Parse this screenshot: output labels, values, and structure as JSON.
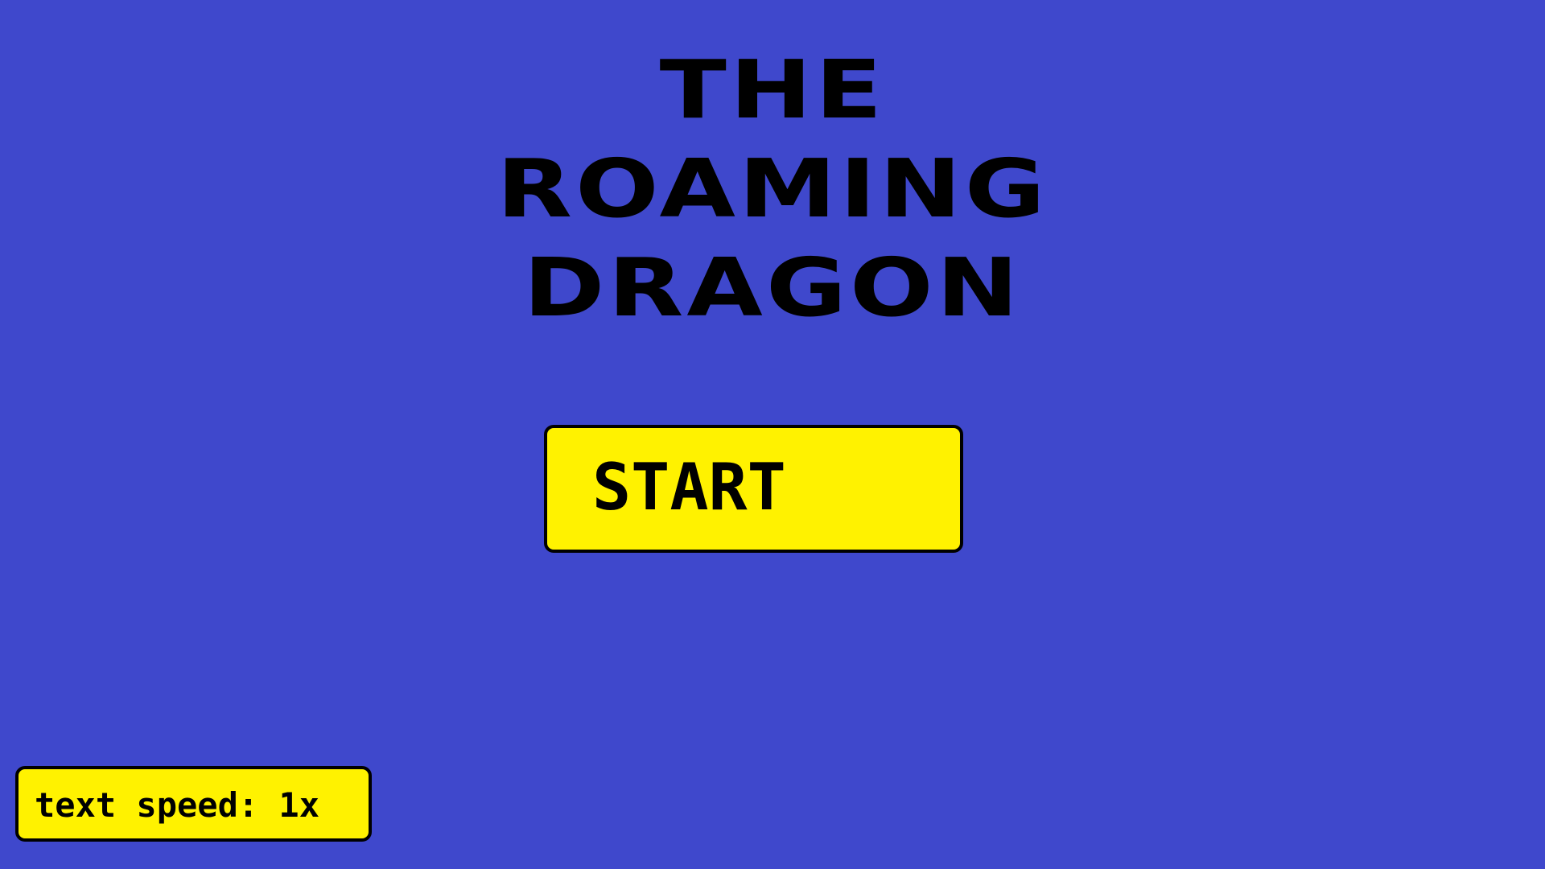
{
  "title": {
    "lines": [
      "THE",
      "ROAMING",
      "DRAGON"
    ]
  },
  "menu": {
    "start_label": "START",
    "text_speed_label": "text speed: 1x"
  },
  "colors": {
    "background": "#3f48cc",
    "button_fill": "#fff200",
    "text": "#000000"
  }
}
